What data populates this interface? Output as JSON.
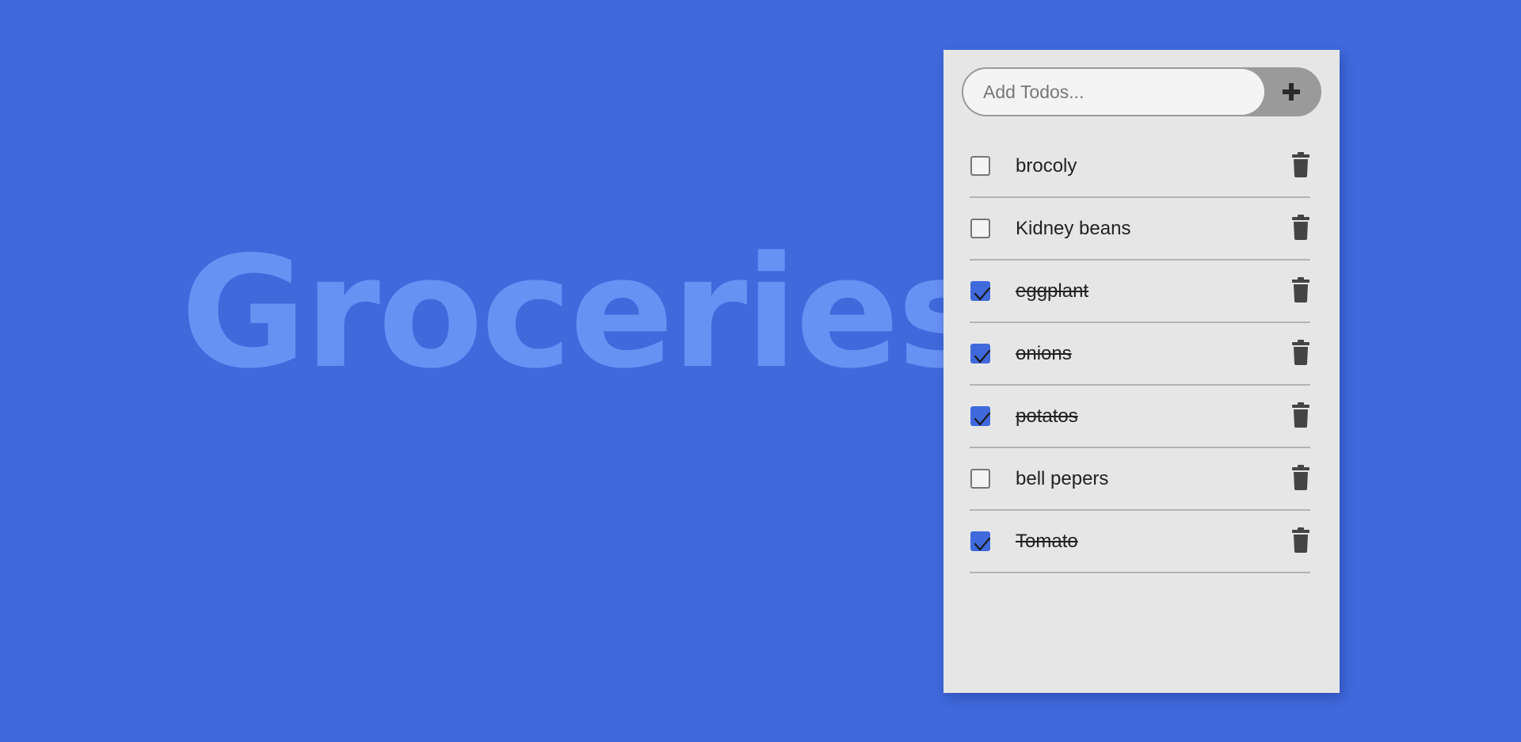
{
  "title": "Groceries",
  "colors": {
    "background": "#4069dc",
    "title": "#6891f4",
    "panel": "#e6e6e6",
    "checked": "#4069dc",
    "icon": "#444444"
  },
  "add_bar": {
    "placeholder": "Add Todos...",
    "value": "",
    "button_icon": "plus-icon"
  },
  "todos": [
    {
      "text": "brocoly",
      "done": false
    },
    {
      "text": "Kidney beans",
      "done": false
    },
    {
      "text": "eggplant",
      "done": true
    },
    {
      "text": "onions",
      "done": true
    },
    {
      "text": "potatos",
      "done": true
    },
    {
      "text": "bell pepers",
      "done": false
    },
    {
      "text": "Tomato",
      "done": true
    }
  ],
  "icons": {
    "delete": "trash-icon",
    "check": "check-icon"
  }
}
